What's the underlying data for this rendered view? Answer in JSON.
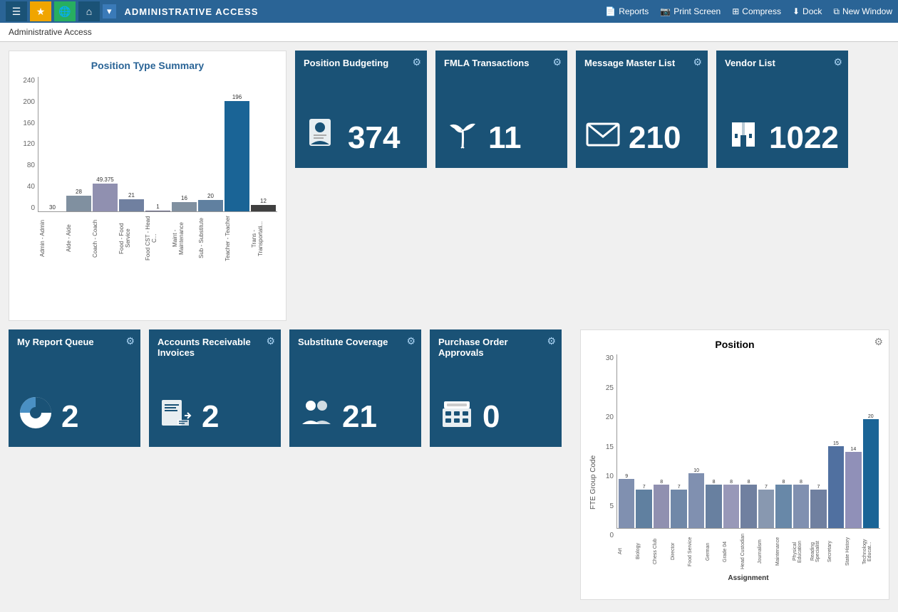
{
  "topNav": {
    "title": "ADMINISTRATIVE ACCESS",
    "buttons": [
      {
        "label": "☰",
        "name": "hamburger-btn",
        "active": false
      },
      {
        "label": "★",
        "name": "favorites-btn",
        "active": true
      },
      {
        "label": "🌐",
        "name": "globe-btn",
        "active": true
      },
      {
        "label": "⌂",
        "name": "home-btn",
        "active": false
      }
    ],
    "dropdownLabel": "▾",
    "actions": [
      {
        "label": "Reports",
        "name": "reports-action",
        "icon": "📄"
      },
      {
        "label": "Print Screen",
        "name": "print-screen-action",
        "icon": "📷"
      },
      {
        "label": "Compress",
        "name": "compress-action",
        "icon": "⊞"
      },
      {
        "label": "Dock",
        "name": "dock-action",
        "icon": "⬇"
      },
      {
        "label": "New Window",
        "name": "new-window-action",
        "icon": "⧉"
      }
    ]
  },
  "breadcrumb": "Administrative Access",
  "topRowChart": {
    "title": "Position Type Summary",
    "yAxisLabels": [
      "240",
      "200",
      "160",
      "120",
      "80",
      "40",
      "0"
    ],
    "bars": [
      {
        "label": "Admin - Admin",
        "value": 30,
        "maxVal": 240,
        "color": "#b0b0b0"
      },
      {
        "label": "Aide - Aide",
        "value": 28,
        "maxVal": 240,
        "color": "#8899aa"
      },
      {
        "label": "Coach - Coach",
        "value": 49.375,
        "maxVal": 240,
        "color": "#9090b0"
      },
      {
        "label": "Food - Food Service",
        "value": 21,
        "maxVal": 240,
        "color": "#7080a0"
      },
      {
        "label": "Food CST - Head C...",
        "value": 1,
        "maxVal": 240,
        "color": "#606080"
      },
      {
        "label": "Maint - Maintenance",
        "value": 16,
        "maxVal": 240,
        "color": "#8090a0"
      },
      {
        "label": "Sub - Substitute",
        "value": 20,
        "maxVal": 240,
        "color": "#6080a0"
      },
      {
        "label": "Teacher - Teacher",
        "value": 196,
        "maxVal": 240,
        "color": "#1a6496"
      },
      {
        "label": "Trans - Transportati...",
        "value": 12,
        "maxVal": 240,
        "color": "#404040"
      }
    ]
  },
  "tiles": [
    {
      "name": "position-budgeting",
      "header": "Position Budgeting",
      "icon": "person-document",
      "number": "374",
      "iconUnicode": "📋"
    },
    {
      "name": "fmla-transactions",
      "header": "FMLA Transactions",
      "icon": "palm-tree",
      "number": "11",
      "iconUnicode": "🌴"
    },
    {
      "name": "message-master-list",
      "header": "Message Master List",
      "icon": "envelope",
      "number": "210",
      "iconUnicode": "✉"
    },
    {
      "name": "vendor-list",
      "header": "Vendor List",
      "icon": "building",
      "number": "1022",
      "iconUnicode": "🏢"
    }
  ],
  "bottomTiles": [
    {
      "name": "my-report-queue",
      "header": "My Report Queue",
      "icon": "pie-chart",
      "number": "2",
      "iconUnicode": "◕"
    },
    {
      "name": "accounts-receivable-invoices",
      "header": "Accounts Receivable Invoices",
      "icon": "invoice",
      "number": "2",
      "iconUnicode": "📑"
    },
    {
      "name": "substitute-coverage",
      "header": "Substitute Coverage",
      "icon": "people",
      "number": "21",
      "iconUnicode": "👥"
    },
    {
      "name": "purchase-order-approvals",
      "header": "Purchase Order Approvals",
      "icon": "cash-register",
      "number": "0",
      "iconUnicode": "🖨"
    }
  ],
  "positionChart": {
    "title": "Position",
    "yAxisLabel": "FTE Group Code",
    "xAxisLabel": "Assignment",
    "yLabels": [
      "30",
      "25",
      "20",
      "15",
      "10",
      "5",
      "0"
    ],
    "bars": [
      {
        "label": "Art",
        "value": 9,
        "max": 30
      },
      {
        "label": "Biology",
        "value": 7,
        "max": 30
      },
      {
        "label": "Chess Club",
        "value": 8,
        "max": 30
      },
      {
        "label": "Director",
        "value": 7,
        "max": 30
      },
      {
        "label": "Food Service",
        "value": 10,
        "max": 30
      },
      {
        "label": "German",
        "value": 8,
        "max": 30
      },
      {
        "label": "Grade 04",
        "value": 8,
        "max": 30
      },
      {
        "label": "Head Custodian",
        "value": 8,
        "max": 30
      },
      {
        "label": "Journalism",
        "value": 7,
        "max": 30
      },
      {
        "label": "Maintenance",
        "value": 8,
        "max": 30
      },
      {
        "label": "Physical Education",
        "value": 8,
        "max": 30
      },
      {
        "label": "Reading Specialist",
        "value": 7,
        "max": 30
      },
      {
        "label": "Secretary",
        "value": 15,
        "max": 30
      },
      {
        "label": "State History",
        "value": 14,
        "max": 30
      },
      {
        "label": "Technology Educat...",
        "value": 20,
        "max": 30
      }
    ],
    "barValueLabels": [
      "9",
      "7",
      "8",
      "7",
      "10",
      "8",
      "8",
      "8",
      "7",
      "8",
      "8",
      "7",
      "15",
      "14",
      "20"
    ]
  }
}
